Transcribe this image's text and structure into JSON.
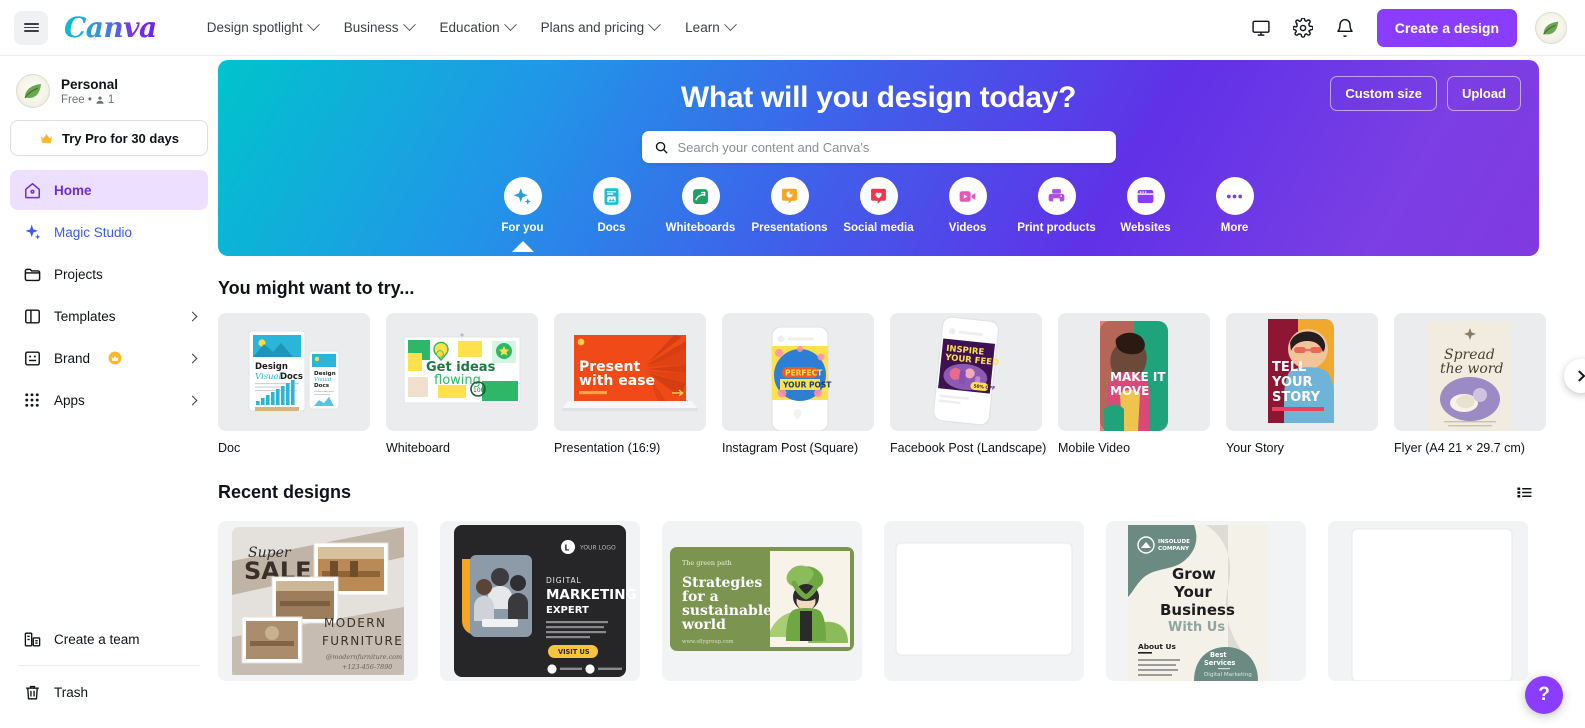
{
  "topnav": {
    "menu_icon": "hamburger-icon",
    "brand": "Canva",
    "links": [
      {
        "label": "Design spotlight"
      },
      {
        "label": "Business"
      },
      {
        "label": "Education"
      },
      {
        "label": "Plans and pricing"
      },
      {
        "label": "Learn"
      }
    ],
    "icons": [
      "monitor-icon",
      "gear-icon",
      "bell-icon"
    ],
    "cta_label": "Create a design"
  },
  "sidebar": {
    "account": {
      "name": "Personal",
      "meta": "Free •",
      "member_count": "1"
    },
    "try_pro_label": "Try Pro for 30 days",
    "items": [
      {
        "label": "Home",
        "icon": "home-icon",
        "active": true
      },
      {
        "label": "Magic Studio",
        "icon": "sparkle-icon"
      },
      {
        "label": "Projects",
        "icon": "folder-icon"
      },
      {
        "label": "Templates",
        "icon": "templates-icon",
        "chevron": true
      },
      {
        "label": "Brand",
        "icon": "brand-icon",
        "chevron": true,
        "crown": true
      },
      {
        "label": "Apps",
        "icon": "apps-icon",
        "chevron": true
      }
    ],
    "bottom": [
      {
        "label": "Create a team",
        "icon": "team-icon"
      },
      {
        "label": "Trash",
        "icon": "trash-icon"
      }
    ]
  },
  "hero": {
    "title": "What will you design today?",
    "custom_size_label": "Custom size",
    "upload_label": "Upload",
    "search_placeholder": "Search your content and Canva's",
    "search_value": "",
    "categories": [
      {
        "label": "For you",
        "icon": "sparkle-icon",
        "color": "#2b9ed8",
        "active": true
      },
      {
        "label": "Docs",
        "icon": "doc-icon",
        "color": "#19c0d4"
      },
      {
        "label": "Whiteboards",
        "icon": "whiteboard-icon",
        "color": "#1da462"
      },
      {
        "label": "Presentations",
        "icon": "presentation-icon",
        "color": "#f5a623"
      },
      {
        "label": "Social media",
        "icon": "heart-icon",
        "color": "#f0374a"
      },
      {
        "label": "Videos",
        "icon": "video-icon",
        "color": "#e855b8"
      },
      {
        "label": "Print products",
        "icon": "printer-icon",
        "color": "#b44ce8"
      },
      {
        "label": "Websites",
        "icon": "website-icon",
        "color": "#8b3dff"
      },
      {
        "label": "More",
        "icon": "more-icon",
        "color": "#7a3ce0"
      }
    ]
  },
  "try_section": {
    "title": "You might want to try...",
    "cards": [
      {
        "label": "Doc",
        "art": "doc"
      },
      {
        "label": "Whiteboard",
        "art": "whiteboard",
        "text1": "Get ideas",
        "text2": "flowing"
      },
      {
        "label": "Presentation (16:9)",
        "art": "presentation",
        "text1": "Present",
        "text2": "with ease"
      },
      {
        "label": "Instagram Post (Square)",
        "art": "instagram",
        "text1": "PERFECT",
        "text2": "YOUR POST"
      },
      {
        "label": "Facebook Post (Landscape)",
        "art": "facebook",
        "text1": "INSPIRE",
        "text2": "YOUR FEED"
      },
      {
        "label": "Mobile Video",
        "art": "mobilevideo",
        "text1": "MAKE IT",
        "text2": "MOVE"
      },
      {
        "label": "Your Story",
        "art": "story",
        "text1": "TELL",
        "text2": "YOUR",
        "text3": "STORY"
      },
      {
        "label": "Flyer (A4 21 × 29.7 cm)",
        "art": "flyer",
        "text1": "Spread",
        "text2": "the word"
      }
    ]
  },
  "recent_section": {
    "title": "Recent designs",
    "view_icon": "list-view-icon",
    "designs": [
      {
        "art": "sale",
        "text1": "Super",
        "text2": "SALE",
        "text3": "MODERN",
        "text4": "FURNITURE",
        "text5": "@modernfurniture.com",
        "text6": "+123-456-7890"
      },
      {
        "art": "marketing",
        "text1": "YOUR LOGO",
        "text2": "DIGITAL",
        "text3": "MARKETING",
        "text4": "EXPERT",
        "text5": "VISIT US"
      },
      {
        "art": "green",
        "text1": "The green path",
        "text2": "Strategies",
        "text3": "for a",
        "text4": "sustainable",
        "text5": "world"
      },
      {
        "art": "blank"
      },
      {
        "art": "grow",
        "text1": "INSOLUDE COMPANY",
        "text2": "Grow",
        "text3": "Your",
        "text4": "Business",
        "text5": "With Us",
        "text6": "About Us",
        "text7": "Best Services"
      },
      {
        "art": "blank2"
      }
    ]
  },
  "help": {
    "label": "?"
  }
}
